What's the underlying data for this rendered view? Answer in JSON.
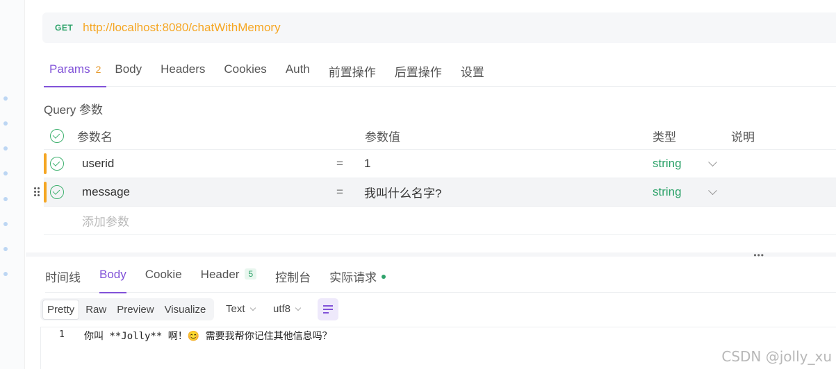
{
  "request": {
    "method": "GET",
    "url": "http://localhost:8080/chatWithMemory"
  },
  "request_tabs": [
    {
      "label": "Params",
      "badge": "2",
      "active": true
    },
    {
      "label": "Body"
    },
    {
      "label": "Headers"
    },
    {
      "label": "Cookies"
    },
    {
      "label": "Auth"
    },
    {
      "label": "前置操作"
    },
    {
      "label": "后置操作"
    },
    {
      "label": "设置"
    }
  ],
  "query": {
    "title": "Query 参数",
    "columns": {
      "name": "参数名",
      "value": "参数值",
      "type": "类型",
      "desc": "说明"
    },
    "rows": [
      {
        "name": "userid",
        "eq": "=",
        "value": "1",
        "type": "string"
      },
      {
        "name": "message",
        "eq": "=",
        "value": "我叫什么名字?",
        "type": "string"
      }
    ],
    "add_placeholder": "添加参数"
  },
  "response_tabs": [
    {
      "label": "时间线"
    },
    {
      "label": "Body",
      "active": true
    },
    {
      "label": "Cookie"
    },
    {
      "label": "Header",
      "badge": "5"
    },
    {
      "label": "控制台"
    },
    {
      "label": "实际请求"
    }
  ],
  "format": {
    "modes": [
      "Pretty",
      "Raw",
      "Preview",
      "Visualize"
    ],
    "active_mode": "Pretty",
    "type": "Text",
    "encoding": "utf8"
  },
  "response_body": {
    "lines": [
      {
        "no": "1",
        "text": "你叫 **Jolly** 啊！😊 需要我帮你记住其他信息吗？"
      }
    ]
  },
  "watermark": "CSDN @jolly_xu",
  "colors": {
    "accent": "#8152d8",
    "method_green": "#2fa36b",
    "url_orange": "#f5a623"
  }
}
